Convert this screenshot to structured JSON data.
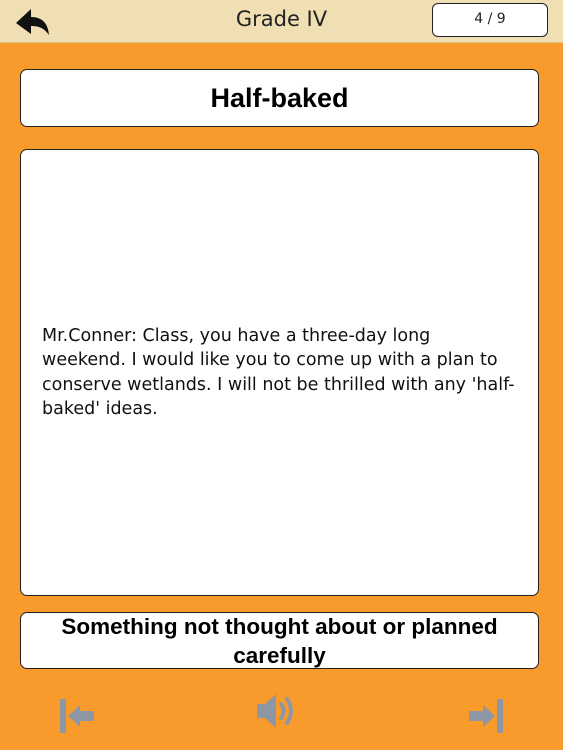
{
  "header": {
    "title": "Grade IV",
    "counter": "4 / 9",
    "back_icon": "back-arrow-icon"
  },
  "card": {
    "term": "Half-baked",
    "example": "Mr.Conner: Class, you have a three-day long weekend. I would like you to come up with a plan to conserve wetlands. I will not be thrilled with any 'half-baked' ideas.",
    "meaning": "Something not thought about or planned carefully"
  },
  "footer": {
    "prev_icon": "first-arrow-icon",
    "sound_icon": "speaker-icon",
    "next_icon": "last-arrow-icon"
  },
  "colors": {
    "background": "#f89a2c",
    "header_bar": "#efdfb2",
    "icon_gray": "#8d97a3"
  }
}
